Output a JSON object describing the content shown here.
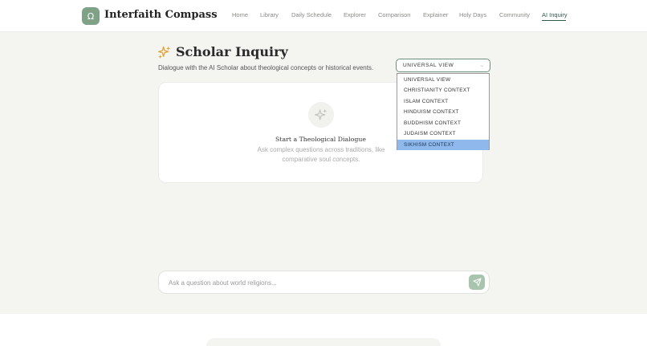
{
  "brand": {
    "logo_glyph": "Ω",
    "name": "Interfaith Compass",
    "accent": "#7fa287"
  },
  "nav": {
    "items": [
      {
        "label": "Home"
      },
      {
        "label": "Library"
      },
      {
        "label": "Daily Schedule"
      },
      {
        "label": "Explorer"
      },
      {
        "label": "Comparison"
      },
      {
        "label": "Explainer"
      },
      {
        "label": "Holy Days"
      },
      {
        "label": "Community"
      },
      {
        "label": "AI Inquiry",
        "active": true
      }
    ],
    "active_color": "#2f5a48"
  },
  "page": {
    "title": "Scholar Inquiry",
    "subtitle": "Dialogue with the AI Scholar about theological concepts or historical events.",
    "title_icon": "sparkles-icon",
    "title_icon_color": "#e2a33a"
  },
  "context_select": {
    "selected": "UNIVERSAL VIEW",
    "options": [
      "UNIVERSAL VIEW",
      "CHRISTIANITY CONTEXT",
      "ISLAM CONTEXT",
      "HINDUISM CONTEXT",
      "BUDDHISM CONTEXT",
      "JUDAISM CONTEXT",
      "SIKHISM CONTEXT"
    ],
    "highlighted": "SIKHISM CONTEXT"
  },
  "empty_state": {
    "icon": "sparkles-icon",
    "title": "Start a Theological Dialogue",
    "description": "Ask complex questions across traditions, like comparative soul concepts."
  },
  "composer": {
    "value": "",
    "placeholder": "Ask a question about world religions...",
    "send_icon": "send-icon",
    "send_color": "#a9c4ad"
  }
}
